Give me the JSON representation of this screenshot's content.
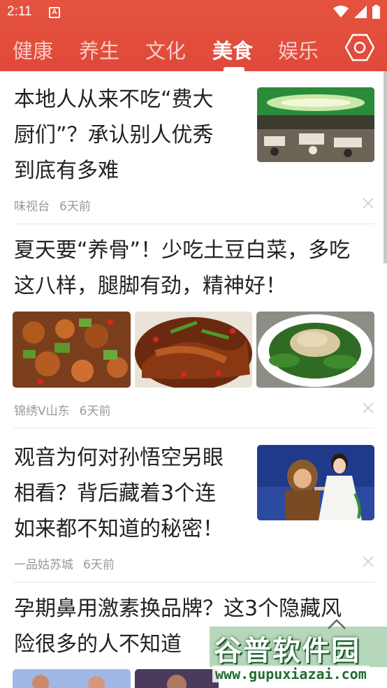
{
  "status_bar": {
    "time": "2:11",
    "app_icon_letter": "A",
    "icons": [
      "wifi-icon",
      "signal-icon",
      "battery-icon"
    ]
  },
  "tabs": [
    {
      "label": "健康",
      "active": false
    },
    {
      "label": "养生",
      "active": false
    },
    {
      "label": "文化",
      "active": false
    },
    {
      "label": "美食",
      "active": true
    },
    {
      "label": "娱乐",
      "active": false
    }
  ],
  "colors": {
    "header": "#e24d3c",
    "text": "#222222",
    "meta": "#999999"
  },
  "articles": [
    {
      "title_lines": [
        "本地人从来不吃“费大",
        "厨们”？承认别人优秀",
        "到底有多难"
      ],
      "source": "味视台",
      "time": "6天前",
      "images": [
        "restaurant-dining-hall"
      ]
    },
    {
      "title_lines": [
        "夏天要“养骨”！少吃土豆白菜，多吃",
        "这八样，腿脚有劲，精神好！"
      ],
      "source": "锦绣V山东",
      "time": "6天前",
      "images": [
        "stir-fried-chicken-cucumber",
        "braised-fish-chili",
        "spinach-sesame-sauce"
      ]
    },
    {
      "title_lines": [
        "观音为何对孙悟空另眼",
        "相看？背后藏着3个连",
        "如来都不知道的秘密！"
      ],
      "source": "一品姑苏城",
      "time": "6天前",
      "images": [
        "monkey-king-and-guanyin"
      ]
    },
    {
      "title_lines": [
        "孕期鼻用激素换品牌？这3个隐藏风",
        "险很多的人不知道"
      ],
      "images": [
        "cartoon-thumb-1",
        "cartoon-thumb-2"
      ]
    }
  ],
  "watermark": {
    "title": "谷普软件园",
    "url": "www.gupuxiazai.com"
  }
}
